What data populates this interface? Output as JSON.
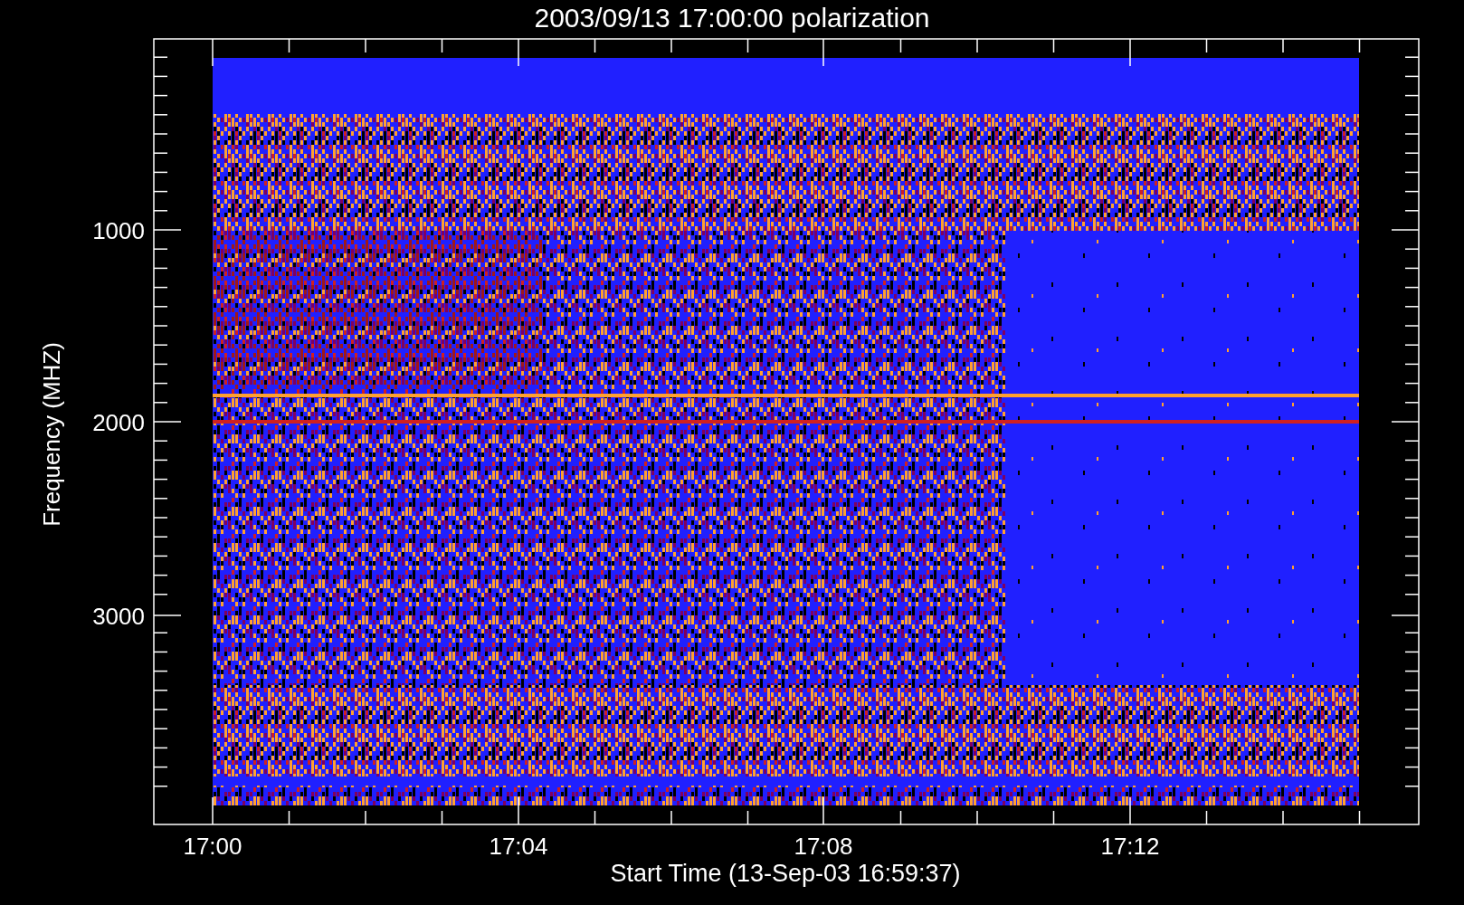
{
  "title": "2003/09/13 17:00:00 polarization",
  "y_axis": {
    "label": "Frequency (MHZ)",
    "ticks": [
      "1000",
      "2000",
      "3000"
    ]
  },
  "x_axis": {
    "label": "Start Time (13-Sep-03 16:59:37)",
    "ticks": [
      "17:00",
      "17:04",
      "17:08",
      "17:12"
    ]
  }
}
